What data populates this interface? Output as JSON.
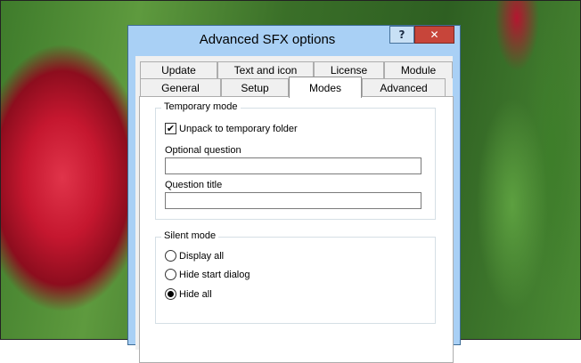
{
  "window": {
    "title": "Advanced SFX options",
    "help_label": "?",
    "close_label": "✕"
  },
  "tabs_row1": [
    {
      "label": "Update"
    },
    {
      "label": "Text and icon"
    },
    {
      "label": "License"
    },
    {
      "label": "Module"
    }
  ],
  "tabs_row2": [
    {
      "label": "General"
    },
    {
      "label": "Setup"
    },
    {
      "label": "Modes",
      "selected": true
    },
    {
      "label": "Advanced"
    }
  ],
  "temporary_mode": {
    "legend": "Temporary mode",
    "unpack_label": "Unpack to temporary folder",
    "unpack_checked": true,
    "check_mark": "✔",
    "optional_question_label": "Optional question",
    "optional_question_value": "",
    "question_title_label": "Question title",
    "question_title_value": ""
  },
  "silent_mode": {
    "legend": "Silent mode",
    "options": [
      {
        "label": "Display all",
        "selected": false
      },
      {
        "label": "Hide start dialog",
        "selected": false
      },
      {
        "label": "Hide all",
        "selected": true
      }
    ]
  },
  "colors": {
    "title_bar": "#a9d0f5",
    "close_button": "#c7453a"
  }
}
